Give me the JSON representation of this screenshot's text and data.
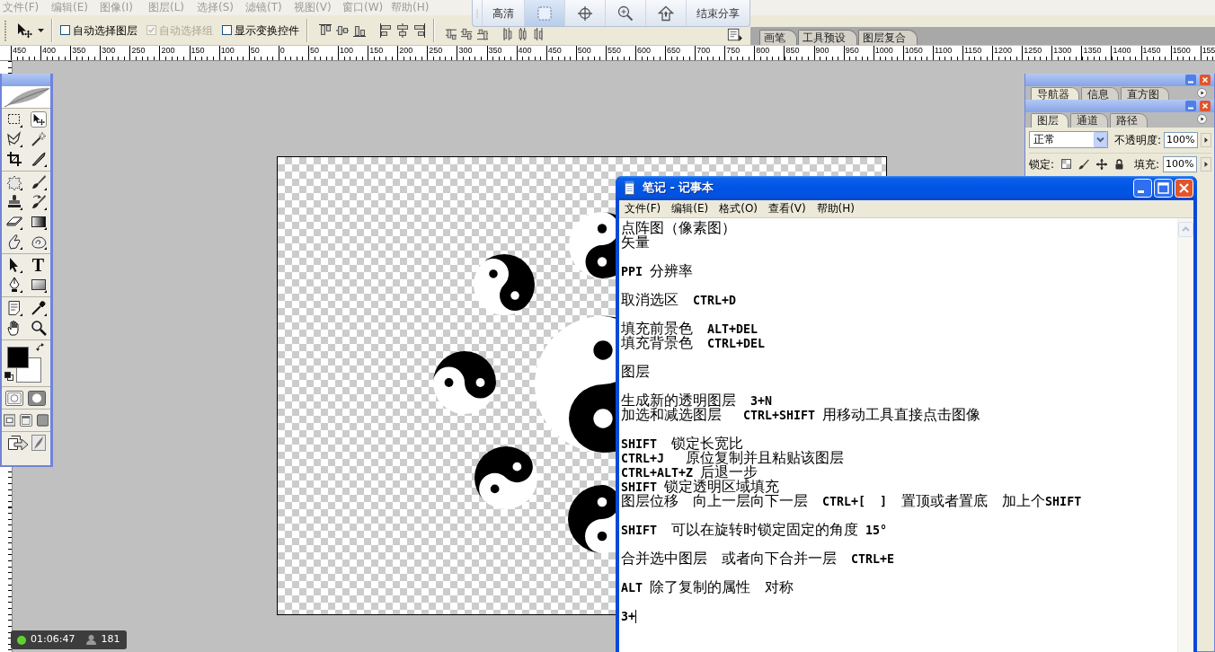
{
  "menu_bar": {
    "items": [
      "文件(F)",
      "编辑(E)",
      "图像(I)",
      "图层(L)",
      "选择(S)",
      "滤镜(T)",
      "视图(V)",
      "窗口(W)",
      "帮助(H)"
    ]
  },
  "options_bar": {
    "checkboxes": [
      {
        "label": "自动选择图层",
        "checked": false,
        "disabled": false
      },
      {
        "label": "自动选择组",
        "checked": true,
        "disabled": true
      },
      {
        "label": "显示变换控件",
        "checked": false,
        "disabled": false
      }
    ],
    "palette_well_tabs": [
      "画笔",
      "工具预设",
      "图层复合"
    ]
  },
  "share_toolbar": {
    "items": [
      {
        "kind": "text",
        "label": "高清",
        "selected": false
      },
      {
        "kind": "region",
        "selected": true
      },
      {
        "kind": "crosshair",
        "selected": false
      },
      {
        "kind": "zoom",
        "selected": false
      },
      {
        "kind": "home",
        "selected": false
      },
      {
        "kind": "text",
        "label": "结束分享",
        "selected": false
      }
    ]
  },
  "ruler": {
    "labels": [
      "450",
      "400",
      "350",
      "300",
      "250",
      "200",
      "150",
      "100",
      "50",
      "0",
      "50",
      "100",
      "150",
      "200",
      "250",
      "300",
      "350",
      "400",
      "450",
      "500",
      "550",
      "600",
      "650",
      "700",
      "750",
      "800",
      "850",
      "900",
      "950",
      "1000",
      "1050",
      "1100",
      "1150",
      "1200",
      "1250",
      "1300",
      "1350",
      "1400",
      "1450",
      "1500",
      "155"
    ]
  },
  "toolbox": {
    "tool_groups": [
      [
        {
          "kind": "marquee",
          "selected": false
        },
        {
          "kind": "move",
          "selected": true
        },
        {
          "kind": "lasso",
          "selected": false
        },
        {
          "kind": "wand",
          "selected": false
        },
        {
          "kind": "crop",
          "selected": false
        },
        {
          "kind": "slice",
          "selected": false
        }
      ],
      [
        {
          "kind": "heal",
          "selected": false
        },
        {
          "kind": "brush",
          "selected": false
        },
        {
          "kind": "stamp",
          "selected": false
        },
        {
          "kind": "history",
          "selected": false
        },
        {
          "kind": "eraser",
          "selected": false
        },
        {
          "kind": "gradient",
          "selected": false
        },
        {
          "kind": "smudge",
          "selected": false
        },
        {
          "kind": "dodge",
          "selected": false
        }
      ],
      [
        {
          "kind": "path",
          "selected": false
        },
        {
          "kind": "type",
          "glyph": "T",
          "selected": false
        },
        {
          "kind": "pen",
          "selected": false
        },
        {
          "kind": "shape",
          "selected": false
        }
      ],
      [
        {
          "kind": "notes",
          "selected": false
        },
        {
          "kind": "eyedropper",
          "selected": false
        },
        {
          "kind": "hand",
          "selected": false
        },
        {
          "kind": "zoom",
          "selected": false
        }
      ]
    ],
    "swatches": [
      {
        "kind": "background",
        "color": "#ffffff"
      },
      {
        "kind": "foreground",
        "color": "#000000"
      }
    ],
    "edit_modes": [
      {
        "kind": "standard",
        "selected": true
      },
      {
        "kind": "quickmask",
        "selected": false
      }
    ],
    "screen_modes": [
      {
        "kind": "window",
        "selected": false
      },
      {
        "kind": "menubar",
        "selected": true
      },
      {
        "kind": "fullscreen",
        "selected": false
      }
    ]
  },
  "navigator_palette": {
    "tabs": [
      {
        "label": "导航器",
        "selected": true
      },
      {
        "label": "信息",
        "selected": false
      },
      {
        "label": "直方图",
        "selected": false
      }
    ]
  },
  "layers_palette": {
    "tabs": [
      {
        "label": "图层",
        "selected": true
      },
      {
        "label": "通道",
        "selected": false
      },
      {
        "label": "路径",
        "selected": false
      }
    ],
    "blend_mode": "正常",
    "opacity_label": "不透明度:",
    "opacity": "100%",
    "lock_label": "锁定:",
    "fill_label": "填充:",
    "fill": "100%"
  },
  "notepad": {
    "title": "笔记 - 记事本",
    "menu": [
      "文件(F)",
      "编辑(E)",
      "格式(O)",
      "查看(V)",
      "帮助(H)"
    ],
    "paragraphs": [
      [
        "点阵图（像素图）",
        "矢量"
      ],
      [
        "PPI 分辨率"
      ],
      [
        "取消选区  CTRL+D"
      ],
      [
        "填充前景色  ALT+DEL",
        "填充背景色  CTRL+DEL"
      ],
      [
        "图层"
      ],
      [
        "生成新的透明图层  3+N",
        "加选和减选图层   CTRL+SHIFT 用移动工具直接点击图像"
      ],
      [
        "SHIFT  锁定长宽比",
        "CTRL+J   原位复制并且粘贴该图层",
        "CTRL+ALT+Z 后退一步",
        "SHIFT 锁定透明区域填充",
        "图层位移  向上一层向下一层  CTRL+[  ]  置顶或者置底  加上个SHIFT"
      ],
      [
        "SHIFT  可以在旋转时锁定固定的角度 15°"
      ],
      [
        "合并选中图层  或者向下合并一层  CTRL+E"
      ],
      [
        "ALT 除了复制的属性  对称"
      ],
      [
        "3+"
      ]
    ],
    "caret": true
  },
  "session_badge": {
    "time": "01:06:47",
    "viewers": "181"
  }
}
